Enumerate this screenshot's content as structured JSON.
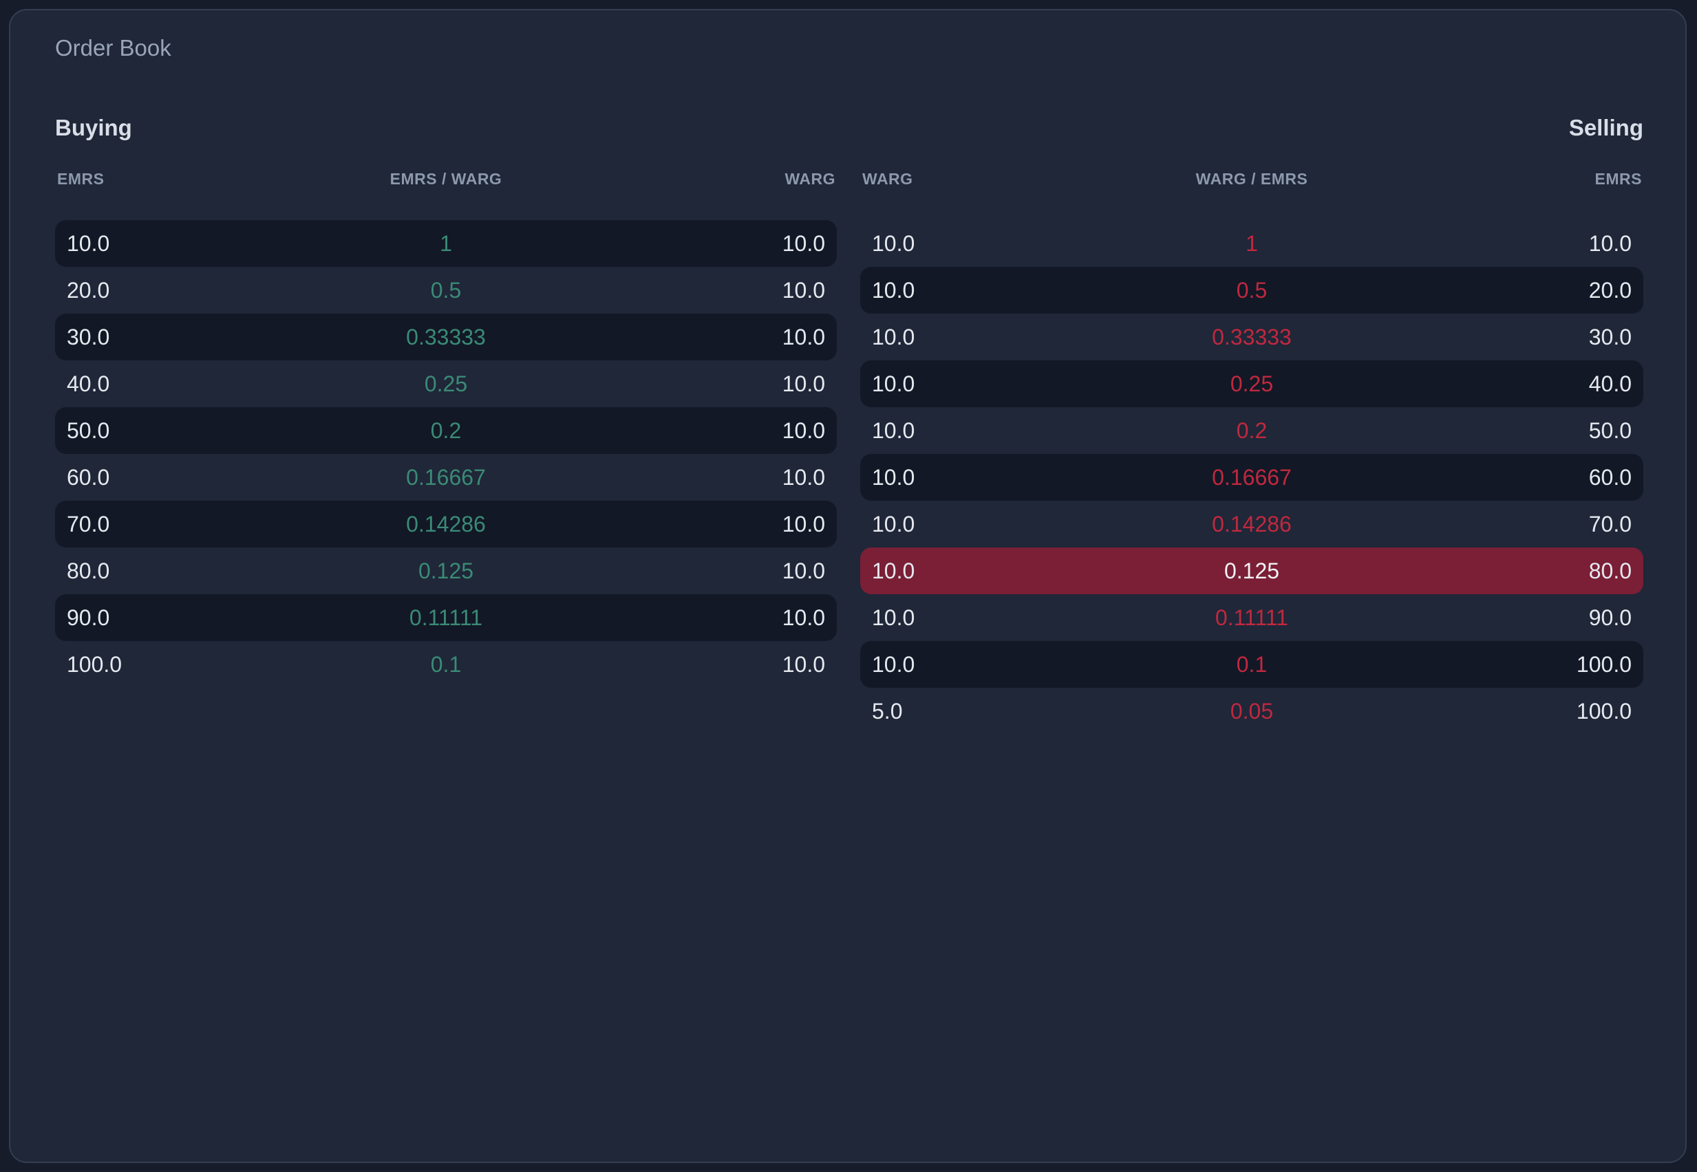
{
  "panel": {
    "title": "Order Book"
  },
  "buying": {
    "heading": "Buying",
    "columns": {
      "left": "EMRS",
      "mid": "EMRS / WARG",
      "right": "WARG"
    },
    "rows": [
      {
        "left": "10.0",
        "mid": "1",
        "right": "10.0"
      },
      {
        "left": "20.0",
        "mid": "0.5",
        "right": "10.0"
      },
      {
        "left": "30.0",
        "mid": "0.33333",
        "right": "10.0"
      },
      {
        "left": "40.0",
        "mid": "0.25",
        "right": "10.0"
      },
      {
        "left": "50.0",
        "mid": "0.2",
        "right": "10.0"
      },
      {
        "left": "60.0",
        "mid": "0.16667",
        "right": "10.0"
      },
      {
        "left": "70.0",
        "mid": "0.14286",
        "right": "10.0"
      },
      {
        "left": "80.0",
        "mid": "0.125",
        "right": "10.0"
      },
      {
        "left": "90.0",
        "mid": "0.11111",
        "right": "10.0"
      },
      {
        "left": "100.0",
        "mid": "0.1",
        "right": "10.0"
      }
    ]
  },
  "selling": {
    "heading": "Selling",
    "columns": {
      "left": "WARG",
      "mid": "WARG / EMRS",
      "right": "EMRS"
    },
    "highlighted_row": 7,
    "rows": [
      {
        "left": "10.0",
        "mid": "1",
        "right": "10.0"
      },
      {
        "left": "10.0",
        "mid": "0.5",
        "right": "20.0"
      },
      {
        "left": "10.0",
        "mid": "0.33333",
        "right": "30.0"
      },
      {
        "left": "10.0",
        "mid": "0.25",
        "right": "40.0"
      },
      {
        "left": "10.0",
        "mid": "0.2",
        "right": "50.0"
      },
      {
        "left": "10.0",
        "mid": "0.16667",
        "right": "60.0"
      },
      {
        "left": "10.0",
        "mid": "0.14286",
        "right": "70.0"
      },
      {
        "left": "10.0",
        "mid": "0.125",
        "right": "80.0"
      },
      {
        "left": "10.0",
        "mid": "0.11111",
        "right": "90.0"
      },
      {
        "left": "10.0",
        "mid": "0.1",
        "right": "100.0"
      },
      {
        "left": "5.0",
        "mid": "0.05",
        "right": "100.0"
      }
    ]
  },
  "colors": {
    "background": "#161c29",
    "panel": "#1f2738",
    "row_stripe": "#121826",
    "buy_price": "#3b8a76",
    "sell_price": "#c0283f",
    "highlight": "#7a1f36"
  }
}
